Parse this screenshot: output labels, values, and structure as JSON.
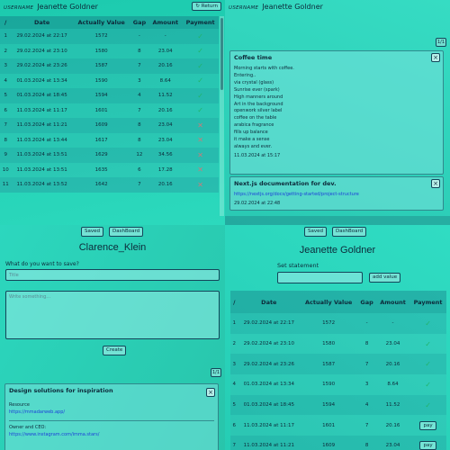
{
  "colors": {
    "check": "#22b36a",
    "cross": "#c77c7c",
    "link": "#1d3ed8"
  },
  "q1": {
    "username_label": "USERNAME",
    "username": "Jeanette Goldner",
    "return_label": "↻ Return",
    "headers": [
      "/",
      "Date",
      "Actually Value",
      "Gap",
      "Amount",
      "Payment"
    ],
    "rows": [
      [
        "1",
        "29.02.2024 at 22:17",
        "1572",
        "-",
        "-",
        "check"
      ],
      [
        "2",
        "29.02.2024 at 23:10",
        "1580",
        "8",
        "23.04",
        "check"
      ],
      [
        "3",
        "29.02.2024 at 23:26",
        "1587",
        "7",
        "20.16",
        "check"
      ],
      [
        "4",
        "01.03.2024 at 13:34",
        "1590",
        "3",
        "8.64",
        "check"
      ],
      [
        "5",
        "01.03.2024 at 18:45",
        "1594",
        "4",
        "11.52",
        "check"
      ],
      [
        "6",
        "11.03.2024 at 11:17",
        "1601",
        "7",
        "20.16",
        "check"
      ],
      [
        "7",
        "11.03.2024 at 11:21",
        "1609",
        "8",
        "23.04",
        "cross"
      ],
      [
        "8",
        "11.03.2024 at 13:44",
        "1617",
        "8",
        "23.04",
        "cross"
      ],
      [
        "9",
        "11.03.2024 at 13:51",
        "1629",
        "12",
        "34.56",
        "cross"
      ],
      [
        "10",
        "11.03.2024 at 13:51",
        "1635",
        "6",
        "17.28",
        "cross"
      ],
      [
        "11",
        "11.03.2024 at 13:52",
        "1642",
        "7",
        "20.16",
        "cross"
      ]
    ]
  },
  "q2": {
    "username_label": "USERNAME",
    "username": "Jeanette Goldner",
    "ratio_label": "1/1",
    "notes": [
      {
        "title": "Coffee time",
        "lines": [
          "Morning starts with coffee.",
          "Entering..",
          "via crystal (glass)",
          "Sunrise ever (spark)",
          "High manners around",
          "Art in the background",
          "openwork silver label",
          "coffee on the table",
          "arabica fragrance",
          "fills up balance",
          "it make a sense",
          "always and ever."
        ],
        "date": "11.03.2024 at 15:17"
      },
      {
        "title": "Next.js documentation for dev.",
        "link": "https://nextjs.org/docs/getting-started/project-structure",
        "date": "29.02.2024 at 22:48"
      }
    ]
  },
  "q3": {
    "saved_label": "Saved",
    "dashboard_label": "DashBoard",
    "name": "Clarence_Klein",
    "prompt": "What do you want to save?",
    "title_placeholder": "Title",
    "text_placeholder": "Write something...",
    "create_label": "Create",
    "ratio_label": "1/1",
    "note": {
      "title": "Design solutions for inspiration",
      "resource_label": "Resource",
      "resource_link": "https://mmadarweb.app/",
      "owner_label": "Owner and CEO:",
      "owner_link": "https://www.instagram.com/imma.stars/"
    }
  },
  "q4": {
    "saved_label": "Saved",
    "dashboard_label": "DashBoard",
    "name": "Jeanette Goldner",
    "set_label": "Set statement",
    "add_label": "add value",
    "headers": [
      "/",
      "Date",
      "Actually Value",
      "Gap",
      "Amount",
      "Payment"
    ],
    "pay_label": "pay",
    "rows": [
      [
        "1",
        "29.02.2024 at 22:17",
        "1572",
        "-",
        "-",
        "check"
      ],
      [
        "2",
        "29.02.2024 at 23:10",
        "1580",
        "8",
        "23.04",
        "check"
      ],
      [
        "3",
        "29.02.2024 at 23:26",
        "1587",
        "7",
        "20.16",
        "check"
      ],
      [
        "4",
        "01.03.2024 at 13:34",
        "1590",
        "3",
        "8.64",
        "check"
      ],
      [
        "5",
        "01.03.2024 at 18:45",
        "1594",
        "4",
        "11.52",
        "check"
      ],
      [
        "6",
        "11.03.2024 at 11:17",
        "1601",
        "7",
        "20.16",
        "pay"
      ],
      [
        "7",
        "11.03.2024 at 11:21",
        "1609",
        "8",
        "23.04",
        "pay"
      ]
    ]
  }
}
